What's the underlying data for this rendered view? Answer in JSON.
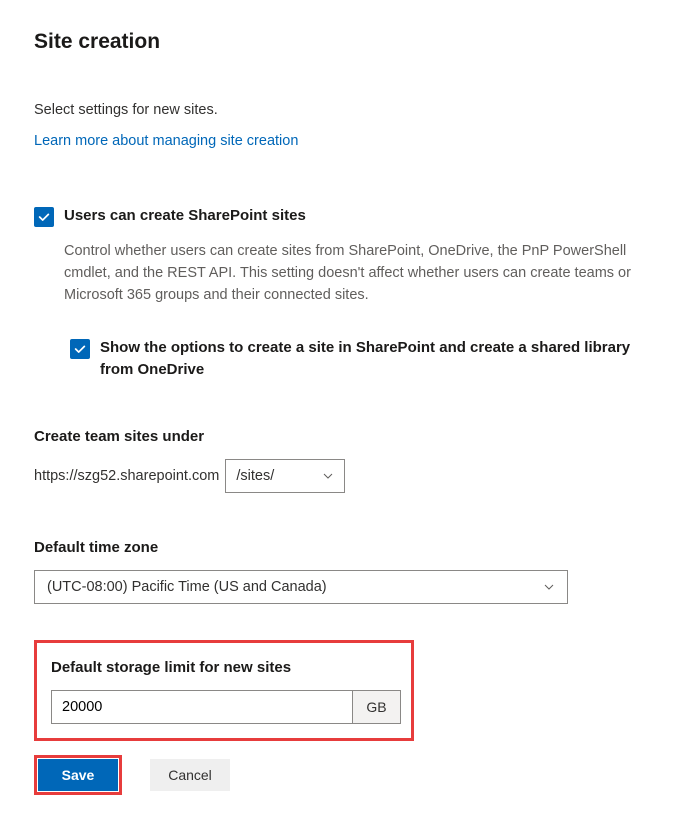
{
  "title": "Site creation",
  "description": "Select settings for new sites.",
  "learn_more": "Learn more about managing site creation",
  "checkbox1": {
    "label": "Users can create SharePoint sites",
    "description": "Control whether users can create sites from SharePoint, OneDrive, the PnP PowerShell cmdlet, and the REST API. This setting doesn't affect whether users can create teams or Microsoft 365 groups and their connected sites.",
    "checked": true
  },
  "checkbox2": {
    "label": "Show the options to create a site in SharePoint and create a shared library from OneDrive",
    "checked": true
  },
  "createUnder": {
    "label": "Create team sites under",
    "url": "https://szg52.sharepoint.com",
    "path": "/sites/"
  },
  "timezone": {
    "label": "Default time zone",
    "value": "(UTC-08:00) Pacific Time (US and Canada)"
  },
  "storage": {
    "label": "Default storage limit for new sites",
    "value": "20000",
    "unit": "GB"
  },
  "buttons": {
    "save": "Save",
    "cancel": "Cancel"
  }
}
